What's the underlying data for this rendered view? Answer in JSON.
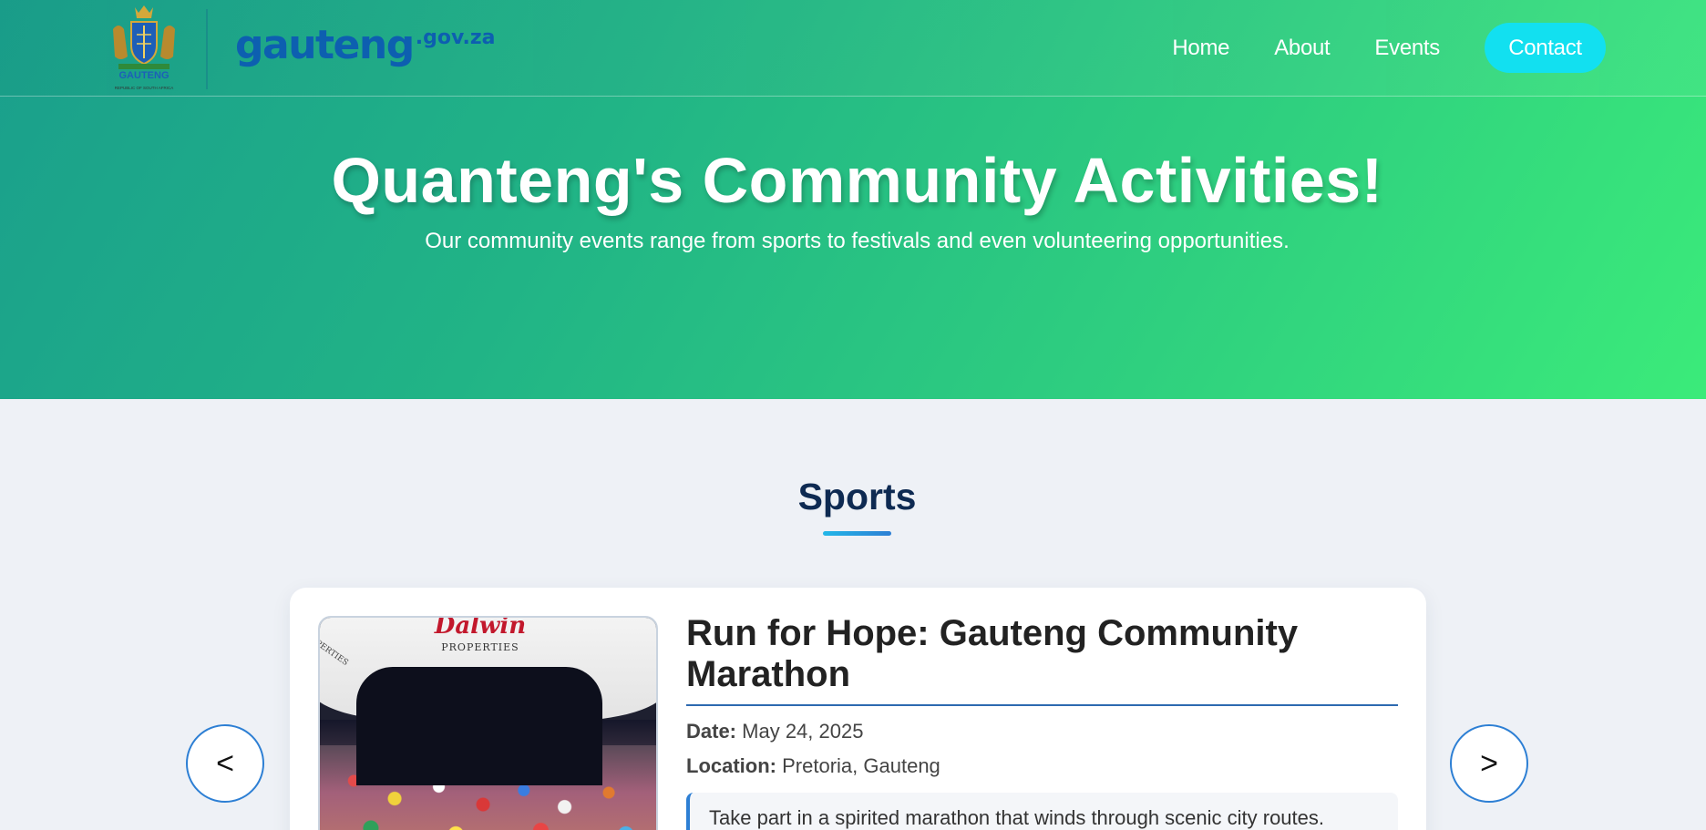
{
  "header": {
    "crest_text": "GAUTENG",
    "crest_subtext": "REPUBLIC OF SOUTH AFRICA",
    "brand_word": "gauteng",
    "brand_tld": ".gov.za",
    "nav": {
      "home": "Home",
      "about": "About",
      "events": "Events",
      "contact": "Contact"
    }
  },
  "hero": {
    "title": "Quanteng's Community Activities!",
    "subtitle": "Our community events range from sports to festivals and even volunteering opportunities."
  },
  "section": {
    "title": "Sports"
  },
  "carousel": {
    "prev_label": "<",
    "next_label": ">",
    "event": {
      "title": "Run for Hope: Gauteng Community Marathon",
      "date_label": "Date:",
      "date": "May 24, 2025",
      "location_label": "Location:",
      "location": "Pretoria, Gauteng",
      "description": "Take part in a spirited marathon that winds through scenic city routes.",
      "photo_banner_text": "Dalwin",
      "photo_banner_sub": "PROPERTIES",
      "photo_side_text": "PERTIES"
    }
  },
  "colors": {
    "hero_gradient_start": "#1a9f8c",
    "hero_gradient_end": "#3beb7a",
    "contact_button": "#12e0f0",
    "section_title": "#0e2a52",
    "accent_blue": "#2d7fd4",
    "brand_blue": "#0d5fb0"
  },
  "icons": {
    "crest": "gauteng-coat-of-arms-icon"
  }
}
